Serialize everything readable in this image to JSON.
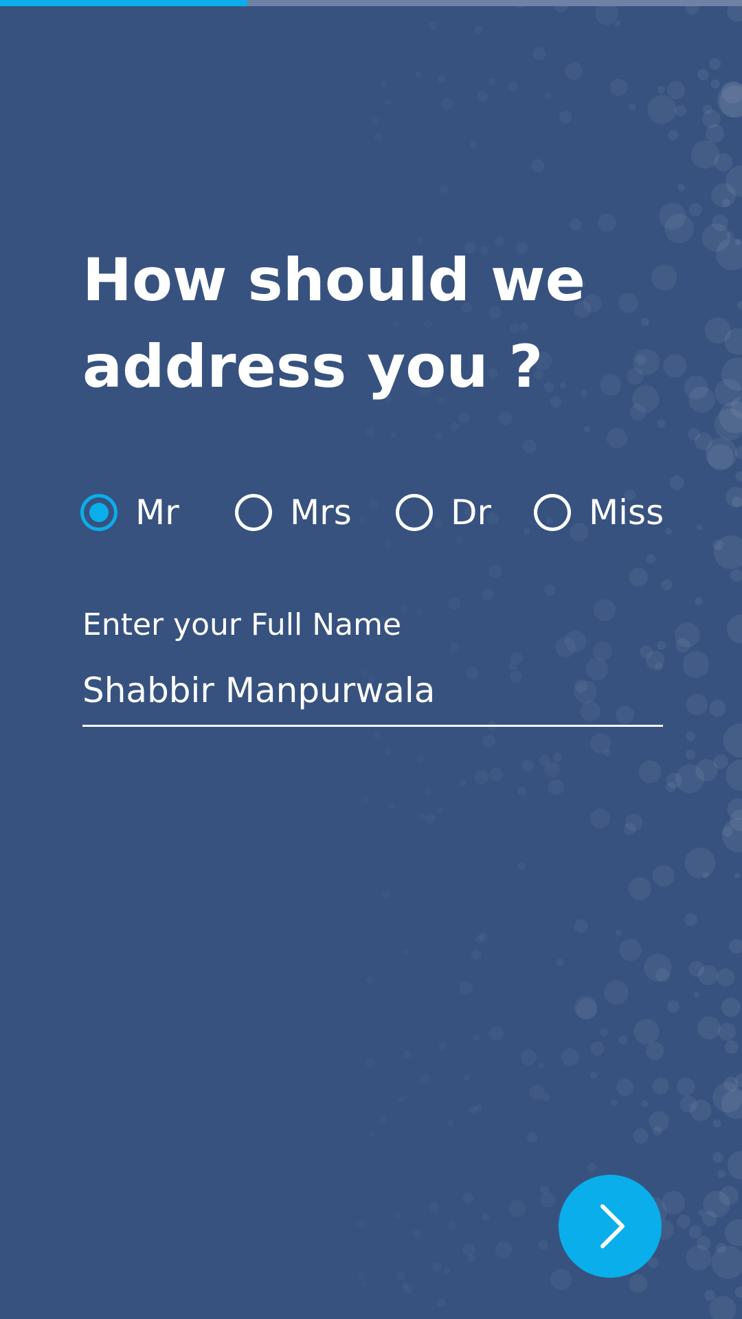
{
  "progress": {
    "fraction": 0.333
  },
  "form": {
    "title_line1": "How should we",
    "title_line2": "address you ?",
    "salutations": [
      {
        "label": "Mr",
        "selected": true
      },
      {
        "label": "Mrs",
        "selected": false
      },
      {
        "label": "Dr",
        "selected": false
      },
      {
        "label": "Miss",
        "selected": false
      }
    ],
    "name_label": "Enter your Full Name",
    "name_value": "Shabbir Manpurwala"
  },
  "next_button": {
    "icon": "chevron-right-icon"
  },
  "colors": {
    "background": "#37527f",
    "accent": "#0aaeea",
    "progress_track": "#6f82a6",
    "text": "#ffffff"
  }
}
